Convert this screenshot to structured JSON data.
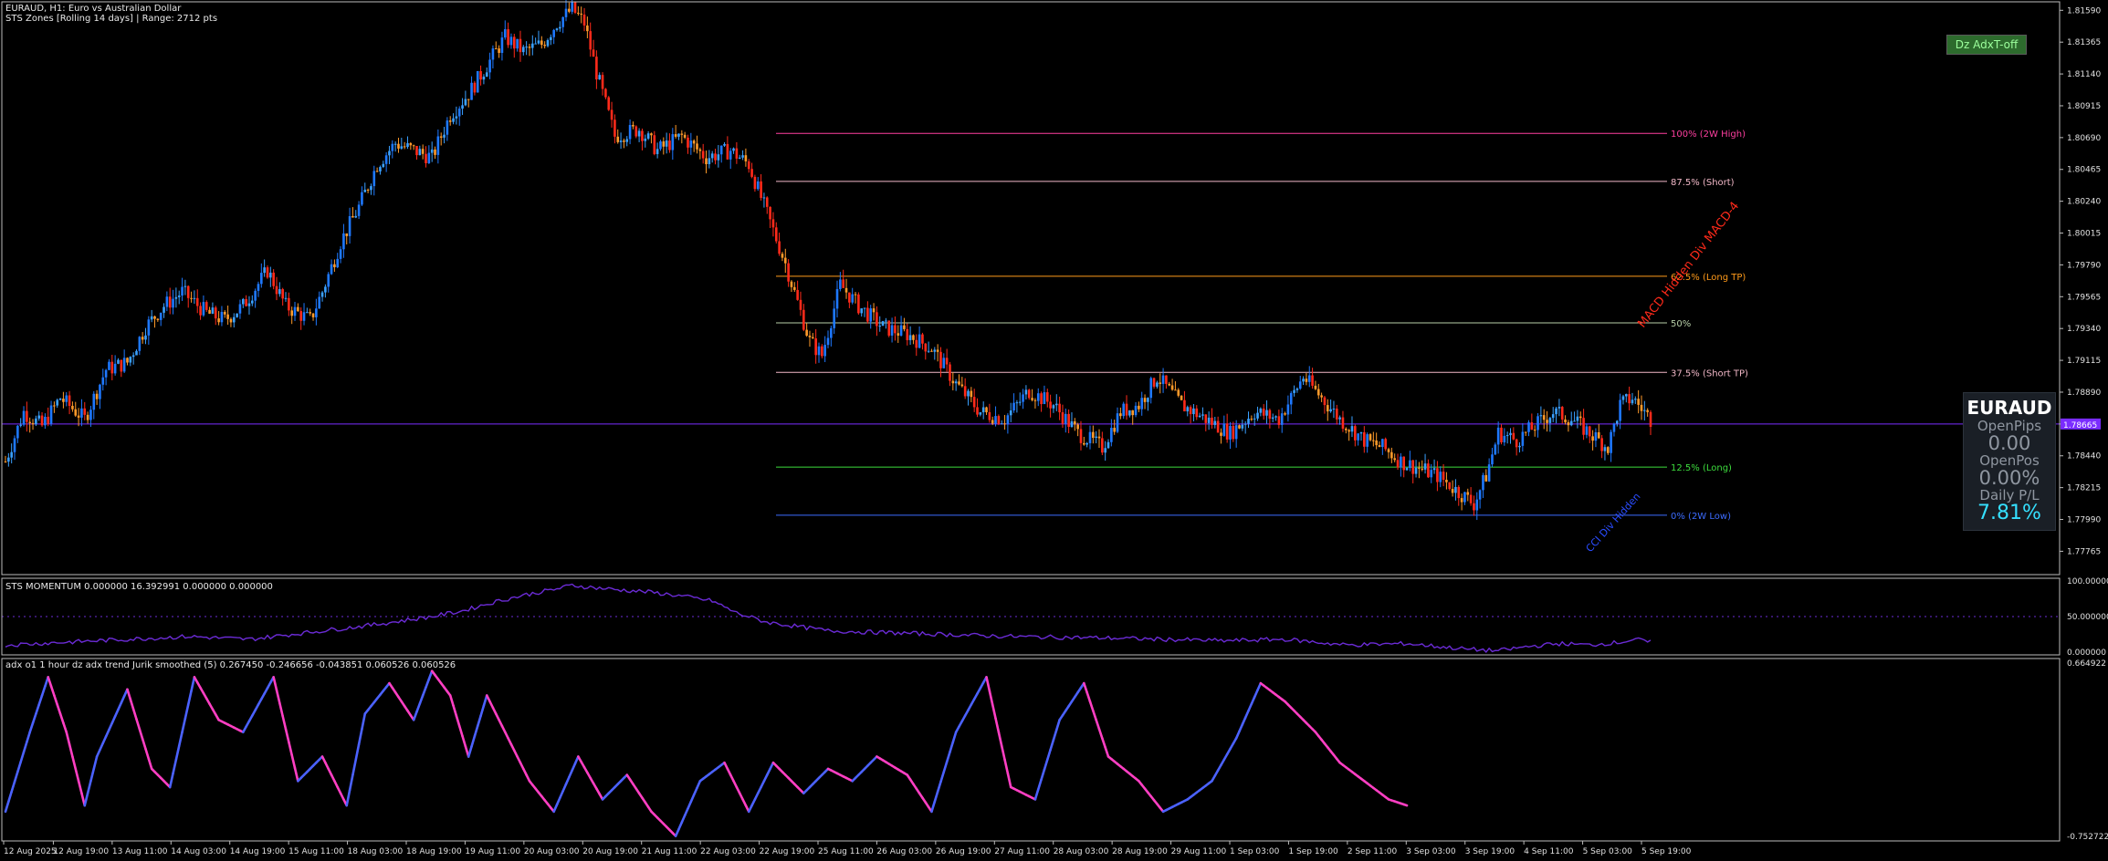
{
  "header": {
    "line1": "EURAUD, H1: Euro vs Australian Dollar",
    "line2": "STS Zones [Rolling 14 days] | Range: 2712 pts",
    "momentum_label": "STS MOMENTUM 0.000000 16.392991 0.000000 0.000000",
    "adx_label": "adx o1 1 hour dz adx trend Jurik smoothed (5) 0.267450 -0.246656 -0.043851 0.060526 0.060526"
  },
  "button": {
    "label": "Dz AdxT-off"
  },
  "panel": {
    "symbol": "EURAUD",
    "open_pips_label": "OpenPips",
    "open_pips": "0.00",
    "open_pos_label": "OpenPos",
    "open_pos": "0.00%",
    "daily_label": "Daily P/L",
    "daily": "7.81%"
  },
  "colors": {
    "background": "#000000",
    "bull": "#1e78ff",
    "bear": "#ff2a1a",
    "bull_small": "#3aa0ff",
    "bear_small": "#ff9a2a",
    "price_line": "#7a2cff",
    "momentum": "#6b2bd6",
    "adx_hi": "#ff3fc3",
    "adx_lo": "#4b62ff",
    "div_bull": "#33c4ff",
    "div_bear": "#ff4fb0"
  },
  "chart_data": [
    {
      "type": "candlestick",
      "symbol": "EURAUD",
      "timeframe": "H1",
      "ylim": [
        1.776,
        1.8165
      ],
      "y_ticks": [
        "1.81590",
        "1.81365",
        "1.81140",
        "1.80915",
        "1.80690",
        "1.80465",
        "1.80240",
        "1.80015",
        "1.79790",
        "1.79565",
        "1.79340",
        "1.79115",
        "1.78890",
        "1.78665",
        "1.78440",
        "1.78215",
        "1.77990",
        "1.77765"
      ],
      "current_price": 1.78665,
      "current_price_label": "1.78665",
      "x_labels": [
        "12 Aug 2025",
        "12 Aug 19:00",
        "13 Aug 11:00",
        "14 Aug 03:00",
        "14 Aug 19:00",
        "15 Aug 11:00",
        "18 Aug 03:00",
        "18 Aug 19:00",
        "19 Aug 11:00",
        "20 Aug 03:00",
        "20 Aug 19:00",
        "21 Aug 11:00",
        "22 Aug 03:00",
        "22 Aug 19:00",
        "25 Aug 11:00",
        "26 Aug 03:00",
        "26 Aug 19:00",
        "27 Aug 11:00",
        "28 Aug 03:00",
        "28 Aug 19:00",
        "29 Aug 11:00",
        "1 Sep 03:00",
        "1 Sep 19:00",
        "2 Sep 11:00",
        "3 Sep 03:00",
        "3 Sep 19:00",
        "4 Sep 11:00",
        "5 Sep 03:00",
        "5 Sep 19:00"
      ],
      "close_path": [
        [
          0,
          1.784
        ],
        [
          6,
          1.7875
        ],
        [
          12,
          1.7865
        ],
        [
          18,
          1.7885
        ],
        [
          26,
          1.787
        ],
        [
          33,
          1.7905
        ],
        [
          40,
          1.791
        ],
        [
          46,
          1.7935
        ],
        [
          52,
          1.795
        ],
        [
          58,
          1.796
        ],
        [
          66,
          1.7945
        ],
        [
          72,
          1.794
        ],
        [
          78,
          1.795
        ],
        [
          86,
          1.7975
        ],
        [
          92,
          1.795
        ],
        [
          100,
          1.794
        ],
        [
          104,
          1.796
        ],
        [
          110,
          1.7995
        ],
        [
          116,
          1.802
        ],
        [
          122,
          1.805
        ],
        [
          128,
          1.8065
        ],
        [
          134,
          1.806
        ],
        [
          140,
          1.8055
        ],
        [
          146,
          1.8085
        ],
        [
          152,
          1.81
        ],
        [
          158,
          1.812
        ],
        [
          164,
          1.814
        ],
        [
          170,
          1.813
        ],
        [
          176,
          1.8135
        ],
        [
          181,
          1.815
        ],
        [
          186,
          1.816
        ],
        [
          190,
          1.815
        ],
        [
          194,
          1.8115
        ],
        [
          200,
          1.807
        ],
        [
          208,
          1.8075
        ],
        [
          214,
          1.806
        ],
        [
          222,
          1.807
        ],
        [
          230,
          1.8055
        ],
        [
          238,
          1.806
        ],
        [
          244,
          1.805
        ],
        [
          250,
          1.8015
        ],
        [
          256,
          1.798
        ],
        [
          264,
          1.7925
        ],
        [
          268,
          1.7915
        ],
        [
          274,
          1.7965
        ],
        [
          280,
          1.795
        ],
        [
          288,
          1.7935
        ],
        [
          296,
          1.793
        ],
        [
          304,
          1.792
        ],
        [
          312,
          1.7895
        ],
        [
          320,
          1.7875
        ],
        [
          328,
          1.787
        ],
        [
          336,
          1.789
        ],
        [
          344,
          1.788
        ],
        [
          352,
          1.786
        ],
        [
          360,
          1.785
        ],
        [
          366,
          1.7875
        ],
        [
          372,
          1.788
        ],
        [
          378,
          1.79
        ],
        [
          386,
          1.788
        ],
        [
          394,
          1.787
        ],
        [
          402,
          1.786
        ],
        [
          410,
          1.7875
        ],
        [
          418,
          1.787
        ],
        [
          426,
          1.79
        ],
        [
          432,
          1.7885
        ],
        [
          438,
          1.787
        ],
        [
          446,
          1.7855
        ],
        [
          452,
          1.785
        ],
        [
          458,
          1.784
        ],
        [
          464,
          1.7835
        ],
        [
          470,
          1.783
        ],
        [
          476,
          1.782
        ],
        [
          482,
          1.781
        ],
        [
          486,
          1.783
        ],
        [
          490,
          1.786
        ],
        [
          496,
          1.7855
        ],
        [
          502,
          1.7865
        ],
        [
          508,
          1.7875
        ],
        [
          514,
          1.787
        ],
        [
          520,
          1.786
        ],
        [
          526,
          1.785
        ],
        [
          530,
          1.788
        ],
        [
          534,
          1.7885
        ],
        [
          540,
          1.787
        ]
      ],
      "n_bars": 541,
      "zones": [
        {
          "label": "100% (2W High)",
          "price": 1.8072,
          "color": "#ff3fa0"
        },
        {
          "label": "87.5% (Short)",
          "price": 1.8038,
          "color": "#f2b8c8"
        },
        {
          "label": "62.5% (Long TP)",
          "price": 1.7971,
          "color": "#ff9a1a"
        },
        {
          "label": "50%",
          "price": 1.7938,
          "color": "#b8cfa8"
        },
        {
          "label": "37.5% (Short TP)",
          "price": 1.7903,
          "color": "#f2b8c8"
        },
        {
          "label": "12.5% (Long)",
          "price": 1.7836,
          "color": "#3ddc3d"
        },
        {
          "label": "0% (2W Low)",
          "price": 1.7802,
          "color": "#3c6cff"
        }
      ],
      "annotations": [
        {
          "text": "MACD Hidden Div MACD-4",
          "color": "#ff2a1a"
        },
        {
          "text": "CCI Div Hidden",
          "color": "#2a4cff"
        }
      ]
    },
    {
      "type": "line",
      "name": "STS MOMENTUM",
      "ylim": [
        0,
        100
      ],
      "y_ticks": [
        "100.000000",
        "50.000000",
        "0.000000"
      ],
      "values_path": [
        [
          0,
          10
        ],
        [
          20,
          14
        ],
        [
          40,
          18
        ],
        [
          60,
          22
        ],
        [
          80,
          18
        ],
        [
          100,
          28
        ],
        [
          120,
          38
        ],
        [
          140,
          50
        ],
        [
          150,
          58
        ],
        [
          160,
          70
        ],
        [
          170,
          80
        ],
        [
          180,
          88
        ],
        [
          186,
          94
        ],
        [
          190,
          92
        ],
        [
          200,
          88
        ],
        [
          210,
          85
        ],
        [
          220,
          80
        ],
        [
          232,
          72
        ],
        [
          240,
          55
        ],
        [
          250,
          42
        ],
        [
          270,
          30
        ],
        [
          300,
          26
        ],
        [
          330,
          22
        ],
        [
          360,
          20
        ],
        [
          380,
          18
        ],
        [
          400,
          16
        ],
        [
          420,
          18
        ],
        [
          430,
          14
        ],
        [
          440,
          10
        ],
        [
          460,
          12
        ],
        [
          470,
          8
        ],
        [
          480,
          4
        ],
        [
          490,
          2
        ],
        [
          500,
          8
        ],
        [
          510,
          12
        ],
        [
          520,
          10
        ],
        [
          530,
          14
        ],
        [
          535,
          18
        ],
        [
          540,
          14
        ]
      ]
    },
    {
      "type": "line",
      "name": "adx trend Jurik smoothed",
      "ylim": [
        -0.7527,
        0.6649
      ],
      "y_ticks": [
        "0.664922",
        "-0.752722"
      ],
      "values_path": [
        [
          0,
          -0.55
        ],
        [
          8,
          0.1
        ],
        [
          14,
          0.55
        ],
        [
          20,
          0.1
        ],
        [
          26,
          -0.5
        ],
        [
          30,
          -0.1
        ],
        [
          40,
          0.45
        ],
        [
          48,
          -0.2
        ],
        [
          54,
          -0.35
        ],
        [
          62,
          0.55
        ],
        [
          70,
          0.2
        ],
        [
          78,
          0.1
        ],
        [
          88,
          0.55
        ],
        [
          96,
          -0.3
        ],
        [
          104,
          -0.1
        ],
        [
          112,
          -0.5
        ],
        [
          118,
          0.25
        ],
        [
          126,
          0.5
        ],
        [
          134,
          0.2
        ],
        [
          140,
          0.6
        ],
        [
          146,
          0.4
        ],
        [
          152,
          -0.1
        ],
        [
          158,
          0.4
        ],
        [
          164,
          0.1
        ],
        [
          172,
          -0.3
        ],
        [
          180,
          -0.55
        ],
        [
          188,
          -0.1
        ],
        [
          196,
          -0.45
        ],
        [
          204,
          -0.25
        ],
        [
          212,
          -0.55
        ],
        [
          220,
          -0.75
        ],
        [
          228,
          -0.3
        ],
        [
          236,
          -0.15
        ],
        [
          244,
          -0.55
        ],
        [
          252,
          -0.15
        ],
        [
          262,
          -0.4
        ],
        [
          270,
          -0.2
        ],
        [
          278,
          -0.3
        ],
        [
          286,
          -0.1
        ],
        [
          296,
          -0.25
        ],
        [
          304,
          -0.55
        ],
        [
          312,
          0.1
        ],
        [
          322,
          0.55
        ],
        [
          330,
          -0.35
        ],
        [
          338,
          -0.45
        ],
        [
          346,
          0.2
        ],
        [
          354,
          0.5
        ],
        [
          362,
          -0.1
        ],
        [
          372,
          -0.3
        ],
        [
          380,
          -0.55
        ],
        [
          388,
          -0.45
        ],
        [
          396,
          -0.3
        ],
        [
          404,
          0.05
        ],
        [
          412,
          0.5
        ],
        [
          420,
          0.35
        ],
        [
          430,
          0.1
        ],
        [
          438,
          -0.15
        ],
        [
          446,
          -0.3
        ],
        [
          454,
          -0.45
        ],
        [
          460,
          -0.5
        ]
      ]
    }
  ]
}
